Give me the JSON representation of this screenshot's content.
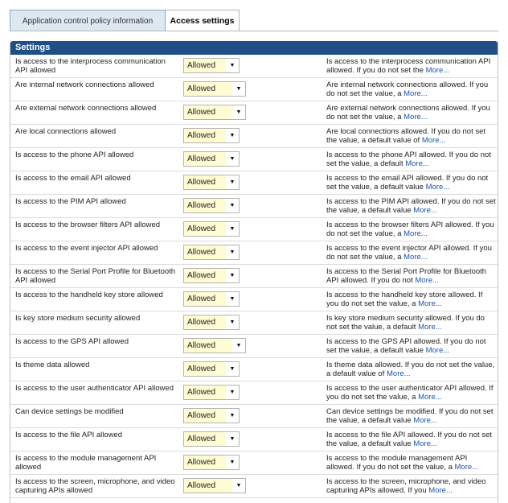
{
  "tabs": [
    {
      "label": "Application control policy information",
      "active": false
    },
    {
      "label": "Access settings",
      "active": true
    }
  ],
  "section_title": "Settings",
  "more_label": "More...",
  "rows": [
    {
      "label": "Is access to the interprocess communication API allowed",
      "value": "Allowed",
      "desc": "Is access to the interprocess communication API allowed. If you do not set the",
      "wide": false
    },
    {
      "label": "Are internal network connections allowed",
      "value": "Allowed",
      "desc": "Are internal network connections allowed. If you do not set the value, a",
      "wide": true
    },
    {
      "label": "Are external network connections allowed",
      "value": "Allowed",
      "desc": "Are external network connections allowed. If you do not set the value, a",
      "wide": true
    },
    {
      "label": "Are local connections allowed",
      "value": "Allowed",
      "desc": "Are local connections allowed. If you do not set the value, a default value of",
      "wide": false
    },
    {
      "label": "Is access to the phone API allowed",
      "value": "Allowed",
      "desc": "Is access to the phone API allowed. If you do not set the value, a default",
      "wide": false
    },
    {
      "label": "Is access to the email API allowed",
      "value": "Allowed",
      "desc": "Is access to the email API allowed. If you do not set the value, a default value",
      "wide": false
    },
    {
      "label": "Is access to the PIM API allowed",
      "value": "Allowed",
      "desc": "Is access to the PIM API allowed. If you do not set the value, a default value",
      "wide": false
    },
    {
      "label": "Is access to the browser filters API allowed",
      "value": "Allowed",
      "desc": "Is access to the browser filters API allowed. If you do not set the value, a",
      "wide": false
    },
    {
      "label": "Is access to the event injector API allowed",
      "value": "Allowed",
      "desc": "Is access to the event injector API allowed. If you do not set the value, a",
      "wide": false
    },
    {
      "label": "Is access to the Serial Port Profile for Bluetooth API allowed",
      "value": "Allowed",
      "desc": "Is access to the Serial Port Profile for Bluetooth API allowed. If you do not",
      "wide": false
    },
    {
      "label": "Is access to the handheld key store allowed",
      "value": "Allowed",
      "desc": "Is access to the handheld key store allowed. If you do not set the value, a",
      "wide": false
    },
    {
      "label": "Is key store medium security allowed",
      "value": "Allowed",
      "desc": "Is key store medium security allowed. If you do not set the value, a default",
      "wide": false
    },
    {
      "label": "Is access to the GPS API allowed",
      "value": "Allowed",
      "desc": "Is access to the GPS API allowed. If you do not set the value, a default value",
      "wide": true
    },
    {
      "label": "Is theme data allowed",
      "value": "Allowed",
      "desc": "Is theme data allowed. If you do not set the value, a default value of",
      "wide": false
    },
    {
      "label": "Is access to the user authenticator API allowed",
      "value": "Allowed",
      "desc": "Is access to the user authenticator API allowed. If you do not set the value, a",
      "wide": false
    },
    {
      "label": "Can device settings be modified",
      "value": "Allowed",
      "desc": "Can device settings be modified. If you do not set the value, a default value",
      "wide": false
    },
    {
      "label": "Is access to the file API allowed",
      "value": "Allowed",
      "desc": "Is access to the file API allowed. If you do not set the value, a default value",
      "wide": false
    },
    {
      "label": "Is access to the module management API allowed",
      "value": "Allowed",
      "desc": "Is access to the module management API allowed. If you do not set the value, a",
      "wide": false
    },
    {
      "label": "Is access to the screen, microphone, and video capturing APIs allowed",
      "value": "Allowed",
      "desc": "Is access to the screen, microphone, and video capturing APIs allowed. If you",
      "wide": true
    }
  ]
}
